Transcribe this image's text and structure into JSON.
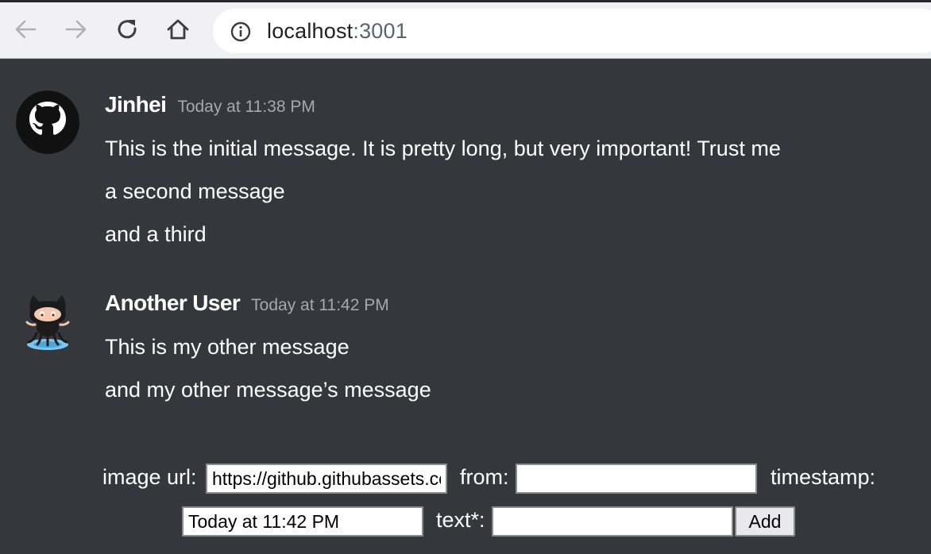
{
  "browser": {
    "url_host": "localhost",
    "url_port": ":3001",
    "icons": [
      "back-arrow-icon",
      "forward-arrow-icon",
      "reload-icon",
      "home-icon",
      "info-icon"
    ]
  },
  "messages": [
    {
      "author": "Jinhei",
      "timestamp": "Today at 11:38 PM",
      "avatar": "github-logo-avatar",
      "lines": [
        "This is the initial message. It is pretty long, but very important! Trust me",
        "a second message",
        "and a third"
      ]
    },
    {
      "author": "Another User",
      "timestamp": "Today at 11:42 PM",
      "avatar": "octocat-avatar",
      "lines": [
        "This is my other message",
        "and my other message’s message"
      ]
    }
  ],
  "form": {
    "image_url_label": "image url:",
    "image_url_value": "https://github.githubassets.com/images/modules/logos_page/Octocat.png",
    "from_label": "from:",
    "from_value": "",
    "timestamp_label": "timestamp:",
    "timestamp_value": "Today at 11:42 PM",
    "text_label": "text*:",
    "text_value": "",
    "add_button_label": "Add"
  },
  "colors": {
    "background": "#36363d",
    "text": "#ffffff",
    "timestamp": "#a7a7ad",
    "browser_bar": "#f1f1f3"
  }
}
